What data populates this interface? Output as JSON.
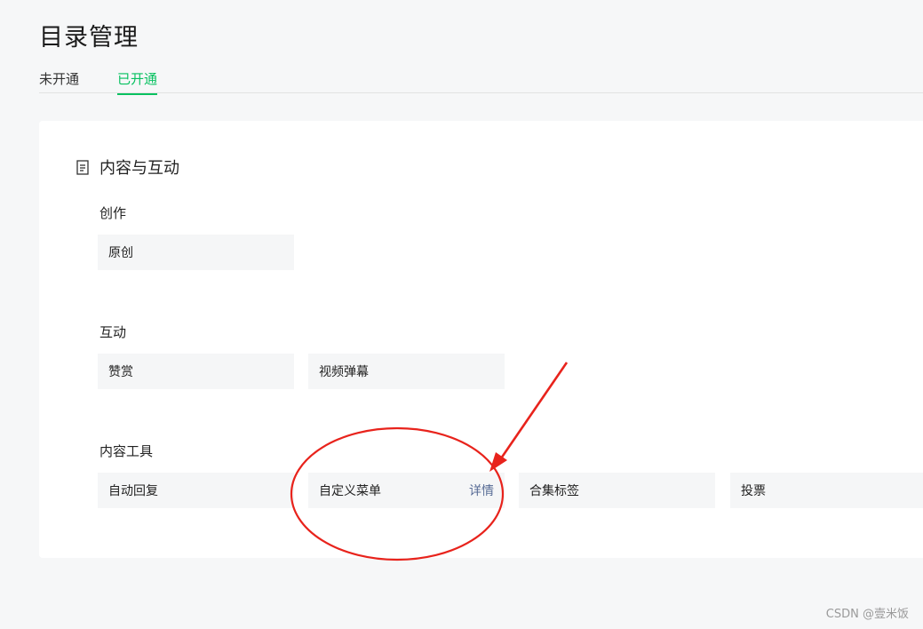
{
  "page": {
    "title": "目录管理"
  },
  "tabs": [
    {
      "label": "未开通",
      "active": false
    },
    {
      "label": "已开通",
      "active": true
    }
  ],
  "section": {
    "title": "内容与互动",
    "icon": "document-icon",
    "groups": [
      {
        "label": "创作",
        "items": [
          {
            "label": "原创"
          }
        ]
      },
      {
        "label": "互动",
        "items": [
          {
            "label": "赞赏"
          },
          {
            "label": "视频弹幕"
          }
        ]
      },
      {
        "label": "内容工具",
        "items": [
          {
            "label": "自动回复"
          },
          {
            "label": "自定义菜单",
            "detail": "详情"
          },
          {
            "label": "合集标签"
          },
          {
            "label": "投票"
          }
        ]
      }
    ]
  },
  "watermark": "CSDN @壹米饭",
  "colors": {
    "accent": "#07c160",
    "link": "#576b95",
    "annotation": "#e8231c"
  }
}
